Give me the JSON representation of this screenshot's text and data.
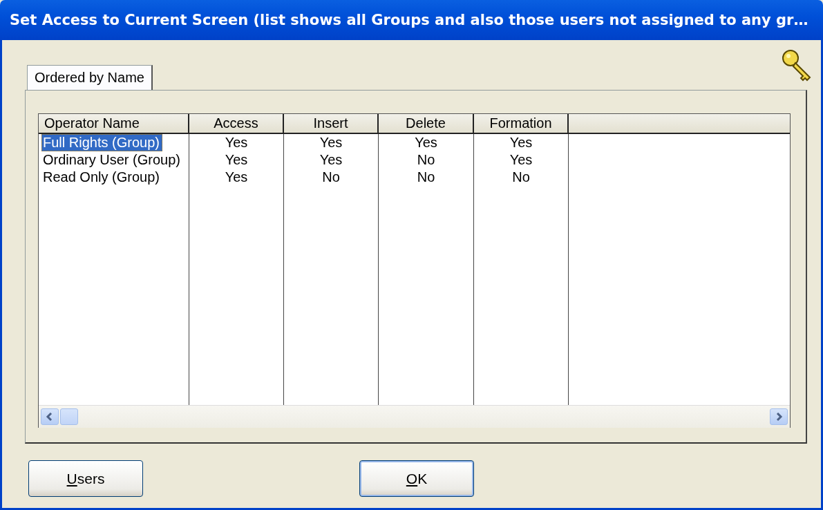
{
  "window": {
    "title": "Set Access to Current Screen (list shows all Groups and also those users not assigned to any gr…"
  },
  "tabs": [
    {
      "label": "Ordered by Name",
      "selected": true
    }
  ],
  "table": {
    "columns": [
      "Operator Name",
      "Access",
      "Insert",
      "Delete",
      "Formation"
    ],
    "rows": [
      {
        "cells": [
          "Full Rights (Group)",
          "Yes",
          "Yes",
          "Yes",
          "Yes"
        ],
        "selected": true
      },
      {
        "cells": [
          "Ordinary User (Group)",
          "Yes",
          "Yes",
          "No",
          "Yes"
        ],
        "selected": false
      },
      {
        "cells": [
          "Read Only (Group)",
          "Yes",
          "No",
          "No",
          "No"
        ],
        "selected": false
      }
    ]
  },
  "buttons": [
    {
      "access_key": "U",
      "label_rest": "sers",
      "default": false
    },
    {
      "access_key": "O",
      "label_rest": "K",
      "default": true
    }
  ]
}
